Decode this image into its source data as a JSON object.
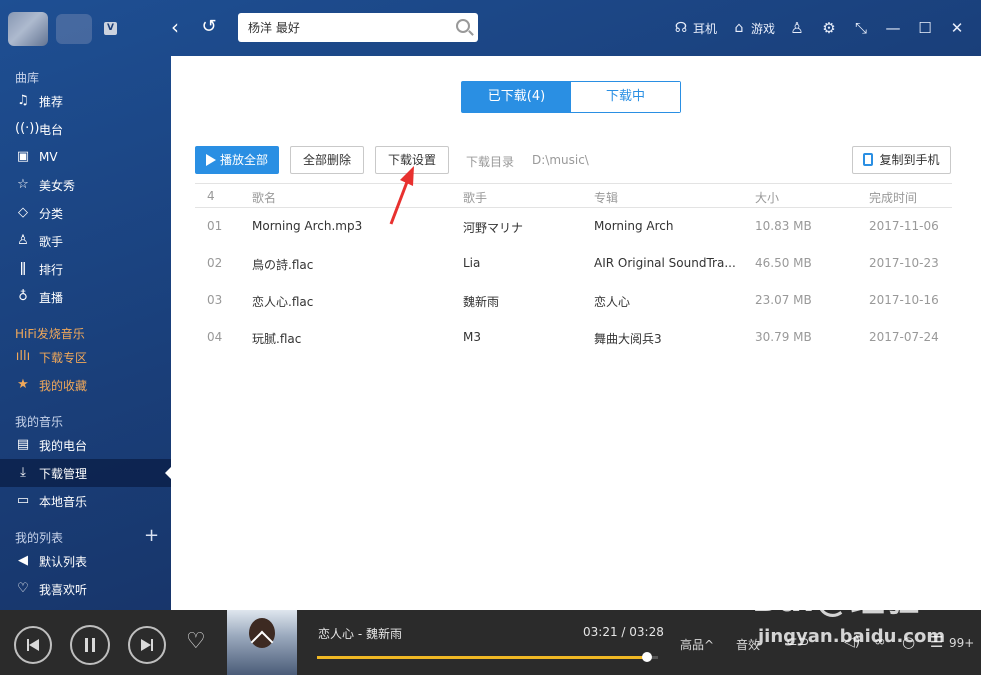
{
  "header": {
    "vip_badge": "V",
    "search_value": "杨洋 最好",
    "right_items": [
      {
        "label": "耳机",
        "icon": "headphones-icon"
      },
      {
        "label": "游戏",
        "icon": "gamepad-icon"
      }
    ]
  },
  "sidebar": {
    "section_library": "曲库",
    "library_items": [
      "推荐",
      "电台",
      "MV",
      "美女秀",
      "分类",
      "歌手",
      "排行",
      "直播"
    ],
    "section_hifi": "HiFi发烧音乐",
    "hifi_items": [
      "下载专区",
      "我的收藏"
    ],
    "section_mymusic": "我的音乐",
    "mymusic_items": [
      "我的电台",
      "下载管理",
      "本地音乐"
    ],
    "section_mylist": "我的列表",
    "mylist_items": [
      "默认列表",
      "我喜欢听"
    ],
    "active_item": "下载管理"
  },
  "main": {
    "tabs": [
      {
        "label": "已下载(4)",
        "active": true
      },
      {
        "label": "下载中",
        "active": false
      }
    ],
    "toolbar": {
      "play_all": "播放全部",
      "delete_all": "全部删除",
      "download_settings": "下载设置",
      "dir_label": "下载目录",
      "dir_value": "D:\\music\\",
      "copy_to_phone": "复制到手机"
    },
    "table": {
      "count": "4",
      "columns": [
        "歌名",
        "歌手",
        "专辑",
        "大小",
        "完成时间"
      ],
      "rows": [
        {
          "num": "01",
          "name": "Morning Arch.mp3",
          "artist": "河野マリナ",
          "album": "Morning Arch",
          "size": "10.83 MB",
          "date": "2017-11-06"
        },
        {
          "num": "02",
          "name": "鳥の詩.flac",
          "artist": "Lia",
          "album": "AIR Original SoundTra...",
          "size": "46.50 MB",
          "date": "2017-10-23"
        },
        {
          "num": "03",
          "name": "恋人心.flac",
          "artist": "魏新雨",
          "album": "恋人心",
          "size": "23.07 MB",
          "date": "2017-10-16"
        },
        {
          "num": "04",
          "name": "玩腻.flac",
          "artist": "M3",
          "album": "舞曲大阅兵3",
          "size": "30.79 MB",
          "date": "2017-07-24"
        }
      ]
    }
  },
  "player": {
    "song": "恋人心 - 魏新雨",
    "time": "03:21 / 03:28",
    "progress": 0.9663,
    "quality": "高品^",
    "effects": "音效",
    "queue_count": "99+"
  },
  "watermark": {
    "line1": "Bai@经验",
    "line2": "jingyan.baidu.com"
  },
  "colors": {
    "accent": "#2a8fe3",
    "sidebar_bg": "#1a3f7a",
    "hifi_orange": "#f0a85a",
    "progress": "#f0b824",
    "annotation_arrow": "#e8312f"
  }
}
